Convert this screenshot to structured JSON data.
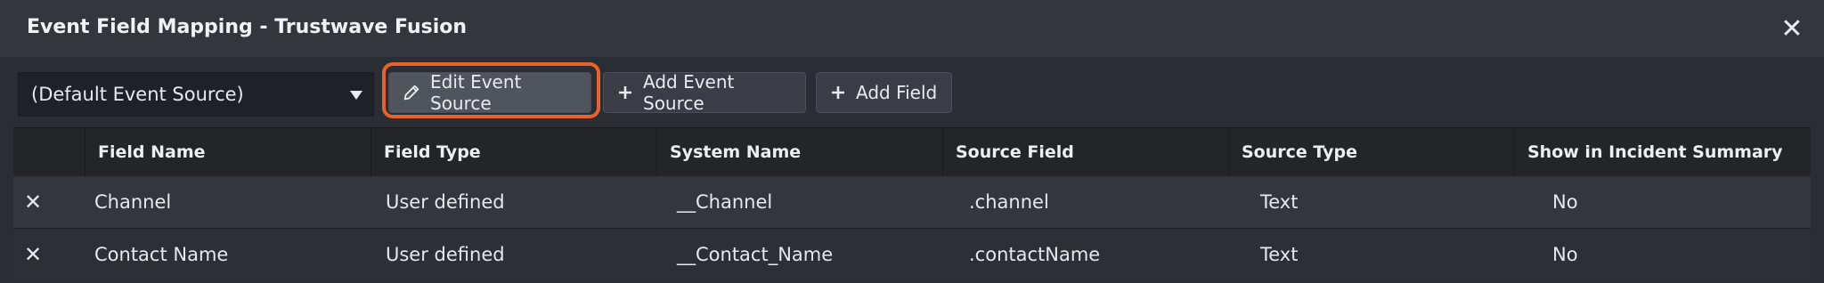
{
  "dialog": {
    "title": "Event Field Mapping - Trustwave Fusion",
    "close_icon": "close-icon"
  },
  "toolbar": {
    "event_source_selected": "(Default Event Source)",
    "edit_event_source_label": "Edit Event Source",
    "add_event_source_label": "Add Event Source",
    "add_field_label": "Add Field",
    "highlight_color": "#e8622c"
  },
  "table": {
    "columns": [
      "Field Name",
      "Field Type",
      "System Name",
      "Source Field",
      "Source Type",
      "Show in Incident Summary"
    ],
    "rows": [
      {
        "field_name": "Channel",
        "field_type": "User defined",
        "system_name": "__Channel",
        "source_field": ".channel",
        "source_type": "Text",
        "show_in_summary": "No"
      },
      {
        "field_name": "Contact Name",
        "field_type": "User defined",
        "system_name": "__Contact_Name",
        "source_field": ".contactName",
        "source_type": "Text",
        "show_in_summary": "No"
      }
    ]
  }
}
